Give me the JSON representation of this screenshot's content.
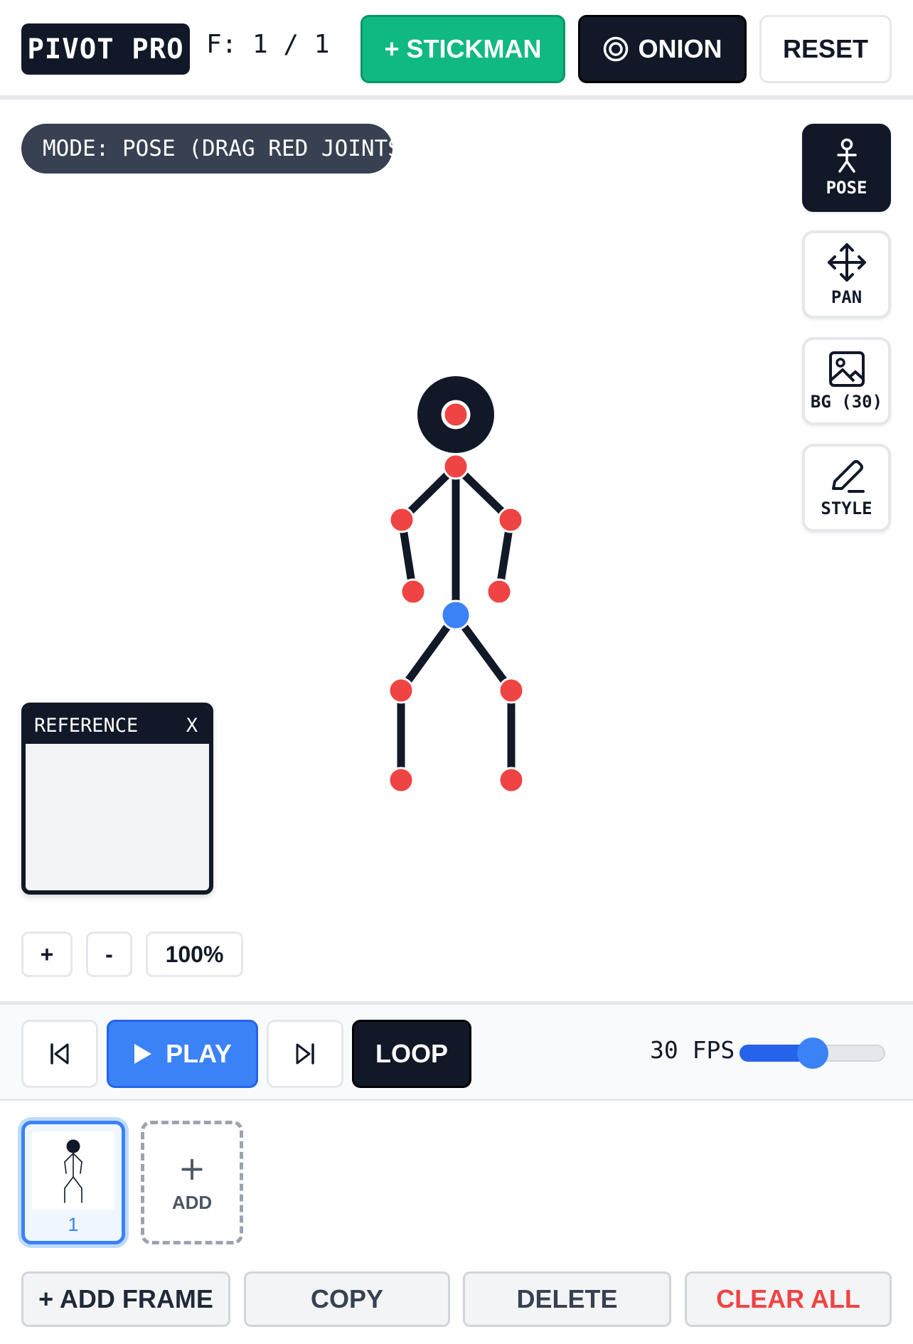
{
  "header": {
    "brand": "PIVOT PRO",
    "frame_counter": "F: 1 / 1",
    "stickman_label": "+ STICKMAN",
    "onion_label": "ONION",
    "reset_label": "RESET"
  },
  "canvas": {
    "mode_label": "MODE: POSE (DRAG RED JOINTS)",
    "tools": [
      {
        "label": "POSE",
        "icon": "stickfigure-icon",
        "active": true
      },
      {
        "label": "PAN",
        "icon": "move-arrows-icon",
        "active": false
      },
      {
        "label": "BG (30)",
        "icon": "image-icon",
        "active": false
      },
      {
        "label": "STYLE",
        "icon": "pencil-icon",
        "active": false
      }
    ],
    "reference": {
      "title": "REFERENCE",
      "close_label": "X"
    },
    "zoom": {
      "in_label": "+",
      "out_label": "-",
      "level": "100%"
    }
  },
  "transport": {
    "play_label": "PLAY",
    "loop_label": "LOOP",
    "fps_label": "30 FPS",
    "fps_fraction": 0.5
  },
  "timeline": {
    "frames": [
      {
        "number": "1",
        "selected": true
      }
    ],
    "add_plus": "+",
    "add_label": "ADD"
  },
  "actions": {
    "add_frame": "+ ADD FRAME",
    "copy": "COPY",
    "delete": "DELETE",
    "clear_all": "CLEAR ALL"
  },
  "colors": {
    "joint": "#ef4444",
    "root_joint": "#3b82f6",
    "bone": "#111827",
    "primary": "#3b82f6",
    "success": "#10b981",
    "danger": "#ef4444"
  }
}
